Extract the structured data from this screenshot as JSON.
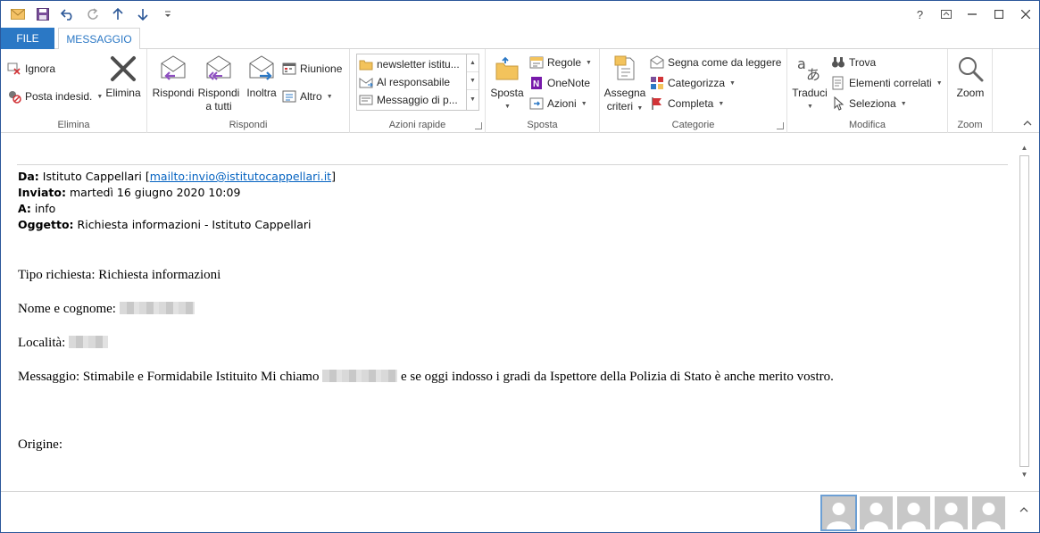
{
  "quick_access": {
    "icons": [
      "mail-icon",
      "save-icon",
      "undo-icon",
      "redo-icon",
      "up-arrow-icon",
      "down-arrow-icon",
      "customize-icon"
    ]
  },
  "window_controls": {
    "help": "?",
    "restore_ribbon": "⊡",
    "minimize": "—",
    "maximize": "☐",
    "close": "✕"
  },
  "tabs": [
    {
      "label": "FILE"
    },
    {
      "label": "MESSAGGIO"
    }
  ],
  "ribbon": {
    "elimina": {
      "label": "Elimina",
      "ignora": "Ignora",
      "posta_indesid": "Posta indesid.",
      "elimina_btn": "Elimina"
    },
    "rispondi": {
      "label": "Rispondi",
      "rispondi": "Rispondi",
      "rispondi_tutti_1": "Rispondi",
      "rispondi_tutti_2": "a tutti",
      "inoltra": "Inoltra",
      "riunione": "Riunione",
      "altro": "Altro"
    },
    "azioni_rapide": {
      "label": "Azioni rapide",
      "items": [
        "newsletter istitu...",
        "Al responsabile",
        "Messaggio di p..."
      ]
    },
    "sposta": {
      "label": "Sposta",
      "sposta_btn": "Sposta",
      "regole": "Regole",
      "onenote": "OneNote",
      "azioni": "Azioni"
    },
    "categorie": {
      "label": "Categorie",
      "assegna_1": "Assegna",
      "assegna_2": "criteri",
      "segna": "Segna come da leggere",
      "categorizza": "Categorizza",
      "completa": "Completa"
    },
    "modifica": {
      "label": "Modifica",
      "traduci": "Traduci",
      "trova": "Trova",
      "elementi": "Elementi correlati",
      "seleziona": "Seleziona"
    },
    "zoom": {
      "label": "Zoom",
      "zoom_btn": "Zoom"
    }
  },
  "message": {
    "from_label": "Da:",
    "from_name": "Istituto Cappellari [",
    "from_link": "mailto:invio@istitutocappellari.it",
    "from_close": "]",
    "sent_label": "Inviato:",
    "sent_value": "martedì 16 giugno 2020 10:09",
    "to_label": "A:",
    "to_value": "info",
    "subject_label": "Oggetto:",
    "subject_value": "Richiesta informazioni - Istituto Cappellari",
    "tipo": "Tipo richiesta: Richiesta informazioni",
    "nome": "Nome e cognome:",
    "localita": "Località:",
    "messaggio_pre": "Messaggio: Stimabile e Formidabile Istituito Mi chiamo",
    "messaggio_post": "e se oggi indosso i gradi da Ispettore della Polizia di Stato è anche merito vostro.",
    "origine": "Origine:"
  },
  "colors": {
    "accent": "#2b78c5",
    "link": "#0563c1",
    "border": "#d5d5d5"
  }
}
